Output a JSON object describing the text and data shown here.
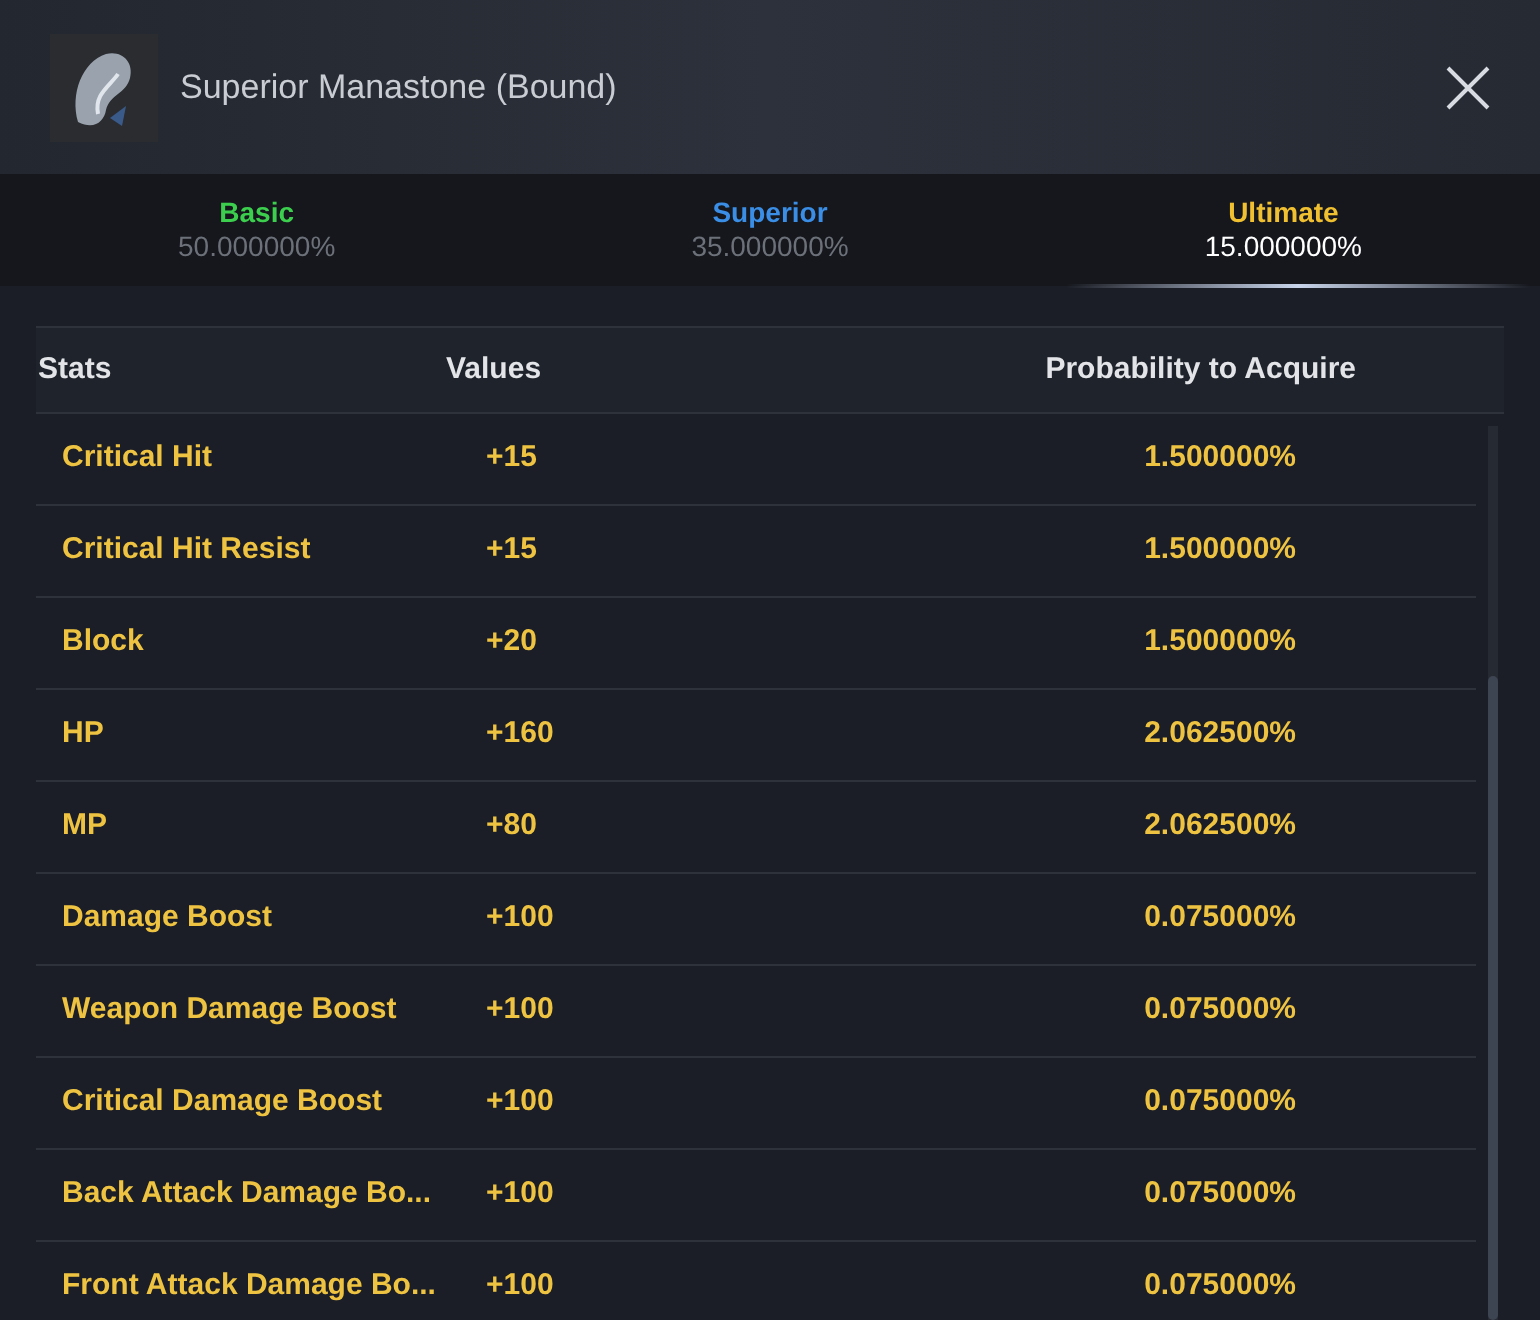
{
  "title": "Superior Manastone (Bound)",
  "tabs": [
    {
      "label": "Basic",
      "value": "50.000000%",
      "color": "#3ccf4e",
      "selected": false
    },
    {
      "label": "Superior",
      "value": "35.000000%",
      "color": "#3a8ee6",
      "selected": false
    },
    {
      "label": "Ultimate",
      "value": "15.000000%",
      "color": "#f0c030",
      "selected": true
    }
  ],
  "table": {
    "columns": [
      "Stats",
      "Values",
      "Probability to Acquire"
    ],
    "rows": [
      {
        "stat": "Critical Hit",
        "value": "+15",
        "probability": "1.500000%"
      },
      {
        "stat": "Critical Hit Resist",
        "value": "+15",
        "probability": "1.500000%"
      },
      {
        "stat": "Block",
        "value": "+20",
        "probability": "1.500000%"
      },
      {
        "stat": "HP",
        "value": "+160",
        "probability": "2.062500%"
      },
      {
        "stat": "MP",
        "value": "+80",
        "probability": "2.062500%"
      },
      {
        "stat": "Damage Boost",
        "value": "+100",
        "probability": "0.075000%"
      },
      {
        "stat": "Weapon Damage Boost",
        "value": "+100",
        "probability": "0.075000%"
      },
      {
        "stat": "Critical Damage Boost",
        "value": "+100",
        "probability": "0.075000%"
      },
      {
        "stat": "Back Attack Damage Bo...",
        "value": "+100",
        "probability": "0.075000%"
      },
      {
        "stat": "Front Attack Damage Bo...",
        "value": "+100",
        "probability": "0.075000%"
      }
    ]
  }
}
